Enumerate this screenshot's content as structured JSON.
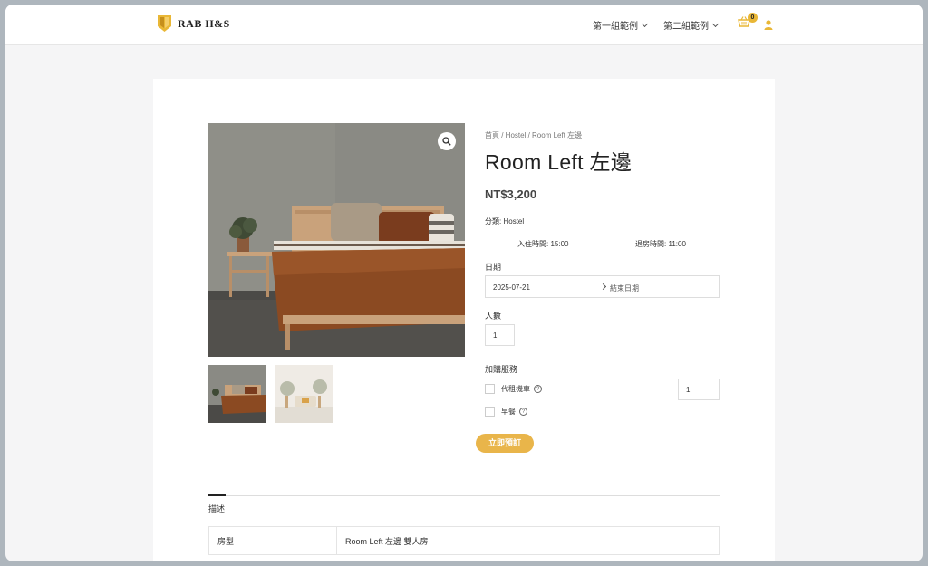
{
  "header": {
    "logo_text": "RAB H&S",
    "nav": [
      {
        "label": "第一組範例"
      },
      {
        "label": "第二組範例"
      }
    ],
    "cart_count": "0",
    "accent_color": "#e9b736"
  },
  "product": {
    "breadcrumb": {
      "home": "首頁",
      "category": "Hostel",
      "current": "Room Left 左邊",
      "separator": " / "
    },
    "title": "Room Left 左邊",
    "price": "NT$3,200",
    "category_label": "分類:",
    "category_value": "Hostel",
    "checkin_label": "入住時間:",
    "checkin_time": "15:00",
    "checkout_label": "退房時間:",
    "checkout_time": "11:00",
    "date_label": "日期",
    "date_start": "2025-07-21",
    "date_end_placeholder": "結束日期",
    "people_label": "人數",
    "people_value": "1",
    "services_label": "加購服務",
    "services": [
      {
        "label": "代租機車",
        "qty": "1"
      },
      {
        "label": "早餐"
      }
    ],
    "book_button": "立即預訂",
    "button_color": "#e9b54a"
  },
  "tabs": {
    "description_label": "描述",
    "table": [
      {
        "key": "房型",
        "value": "Room Left 左邊 雙人房"
      }
    ]
  }
}
